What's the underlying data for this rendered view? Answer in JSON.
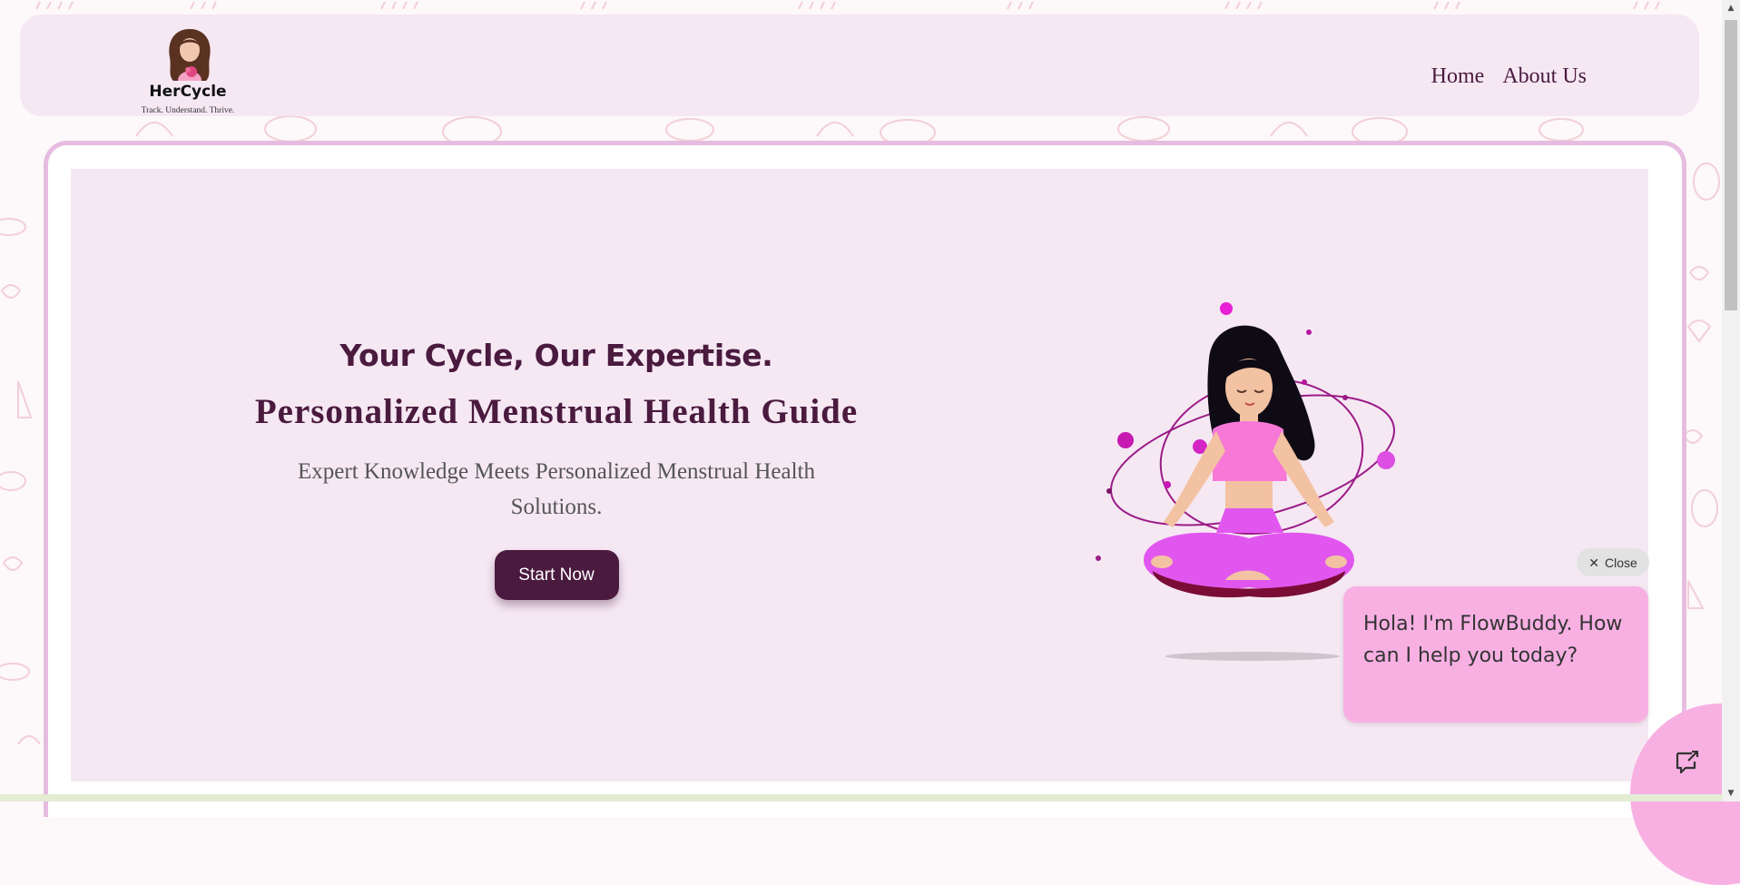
{
  "colors": {
    "brand": "#4a1a3f",
    "nav_background": "#f5e8f3",
    "hero_background": "#f5e8f3",
    "hero_border": "#e6bde0",
    "chat_pink": "#f8b0e3",
    "body_text": "#555555"
  },
  "brand": {
    "name": "HerCycle",
    "tagline": "Track. Understand. Thrive."
  },
  "nav": {
    "items": [
      {
        "label": "Home"
      },
      {
        "label": "About Us"
      }
    ]
  },
  "hero": {
    "title": "Your Cycle, Our Expertise.",
    "subtitle": "Personalized Menstrual Health Guide",
    "description": "Expert Knowledge Meets Personalized Menstrual Health Solutions.",
    "cta_label": "Start Now",
    "illustration_icon": "meditating-woman-illustration"
  },
  "chatbot": {
    "close_label": "Close",
    "close_icon": "close-icon",
    "message": "Hola! I'm FlowBuddy. How can I help you today?",
    "toggle_icon": "chat-icon"
  }
}
